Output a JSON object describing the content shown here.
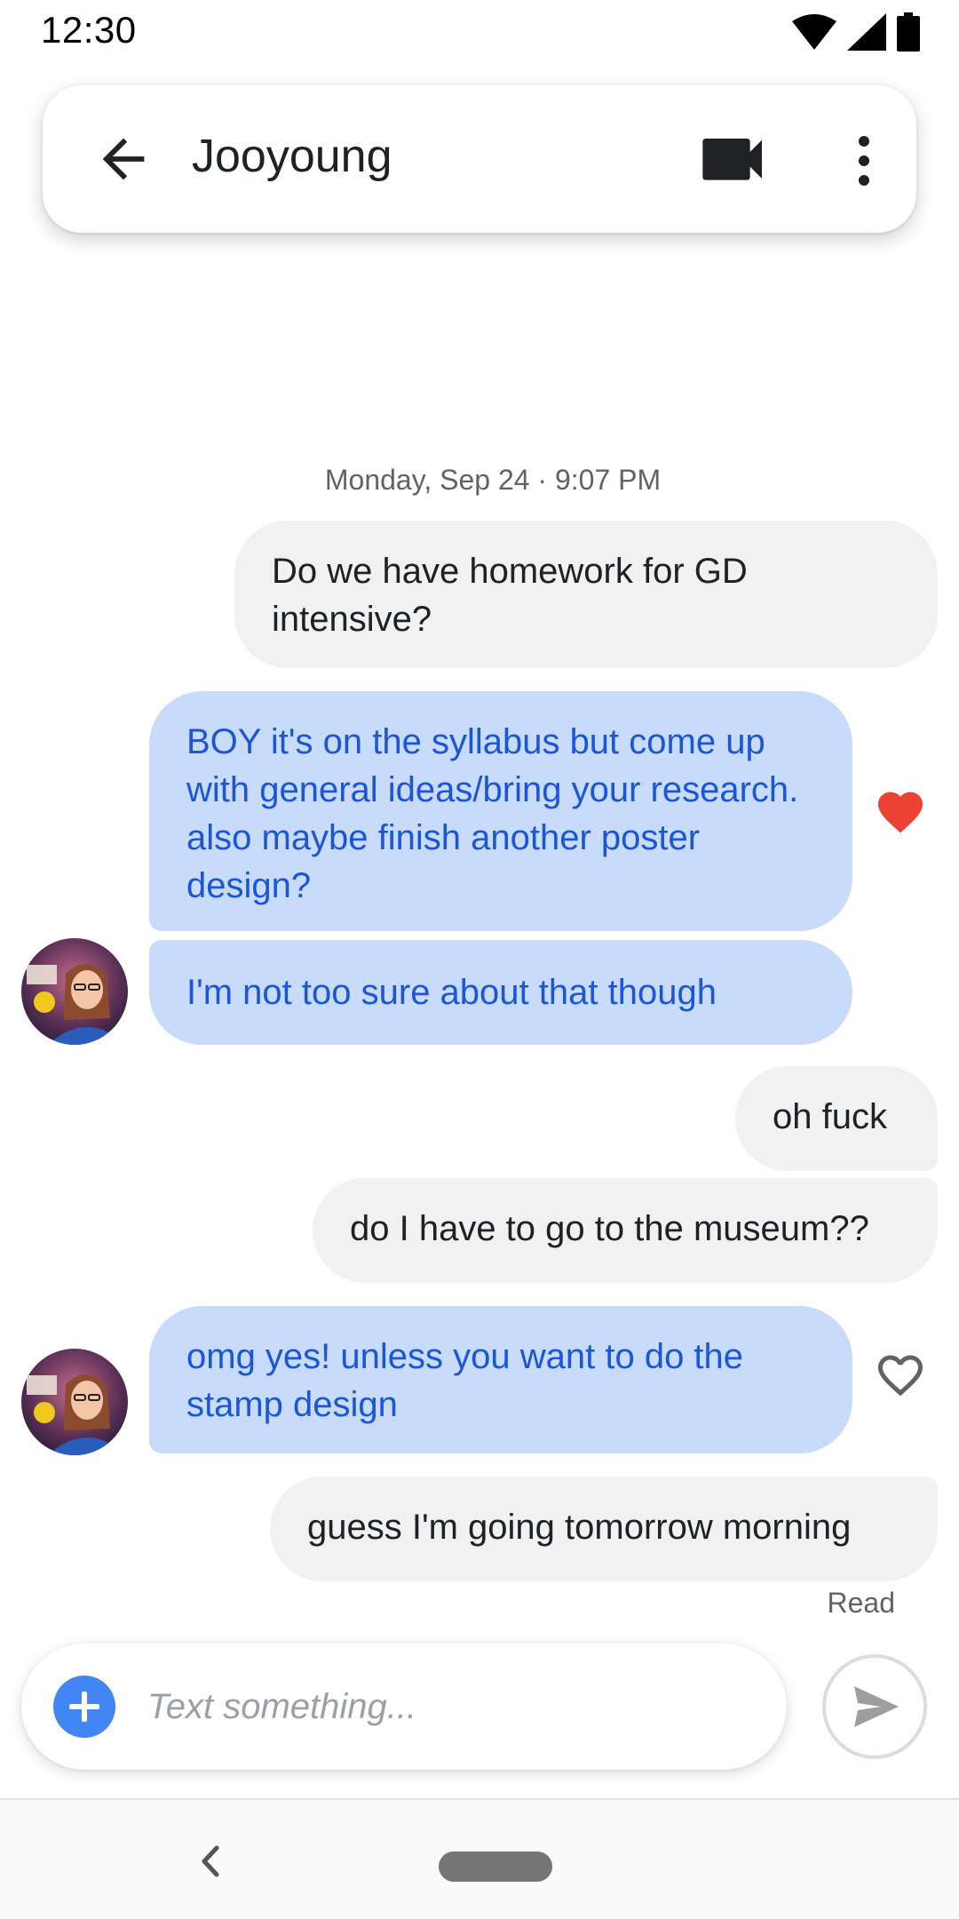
{
  "status_bar": {
    "time": "12:30",
    "icons": [
      "wifi-icon",
      "signal-icon",
      "battery-icon"
    ]
  },
  "header": {
    "contact_name": "Jooyoung",
    "back_icon": "arrow-back-icon",
    "video_icon": "videocam-icon",
    "more_icon": "more-vert-icon"
  },
  "conversation": {
    "timestamp": "Monday, Sep 24 · 9:07 PM",
    "messages": [
      {
        "direction": "outgoing",
        "text": "Do we have homework for GD intensive?"
      },
      {
        "direction": "incoming",
        "text": "BOY it's on the syllabus but come up with general ideas/bring your research. also maybe finish another poster design?",
        "reaction": "heart-filled"
      },
      {
        "direction": "incoming",
        "text": "I'm not too sure about that though"
      },
      {
        "direction": "outgoing",
        "text": "oh fuck"
      },
      {
        "direction": "outgoing",
        "text": "do I have to go to the museum??"
      },
      {
        "direction": "incoming",
        "text": "omg yes! unless you want to do the stamp design",
        "reaction": "heart-outline"
      },
      {
        "direction": "outgoing",
        "text": "guess I'm going tomorrow morning"
      }
    ],
    "read_status": "Read"
  },
  "compose": {
    "placeholder": "Text something...",
    "value": "",
    "attach_icon": "add-circle-icon",
    "send_icon": "send-icon"
  },
  "colors": {
    "incoming_bubble": "#c8dbfa",
    "incoming_text": "#1a56d6",
    "outgoing_bubble": "#f1f1f1",
    "heart_filled": "#ea4335",
    "accent": "#4285f4"
  }
}
